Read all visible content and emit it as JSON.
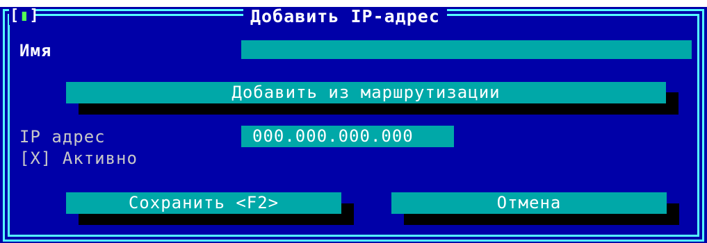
{
  "dialog": {
    "title": "Добавить IP-адрес",
    "close_box": "[",
    "close_dot": "▮",
    "close_box_end": "]"
  },
  "form": {
    "name_label": "Имя",
    "name_value": "",
    "add_from_routing_label": "Добавить из маршрутизации",
    "ip_label": "IP адрес",
    "ip_value": "000.000.000.000",
    "active_box": "[X]",
    "active_label": "Активно"
  },
  "buttons": {
    "save_label": "Сохранить <F2>",
    "cancel_label": "Отмена"
  },
  "colors": {
    "background": "#0000a8",
    "frame": "#55ffff",
    "field": "#00a8a8",
    "shadow": "#000000",
    "text": "#ffffff",
    "dim_text": "#c8c8c8",
    "indicator": "#55ff55"
  }
}
